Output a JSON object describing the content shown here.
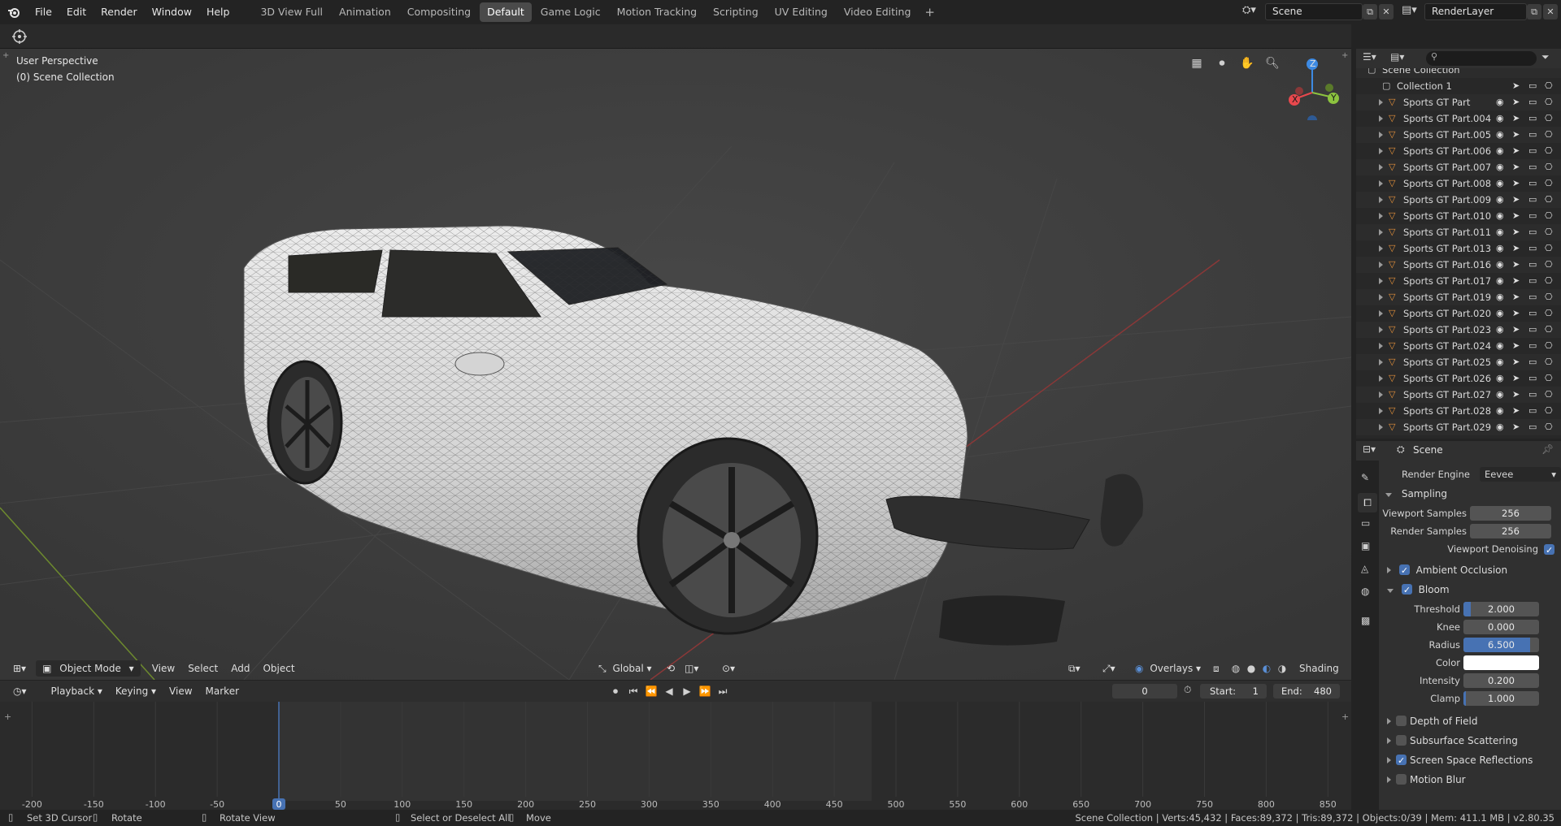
{
  "menu": [
    "File",
    "Edit",
    "Render",
    "Window",
    "Help"
  ],
  "workspaces": [
    {
      "label": "3D View Full",
      "active": false
    },
    {
      "label": "Animation",
      "active": false
    },
    {
      "label": "Compositing",
      "active": false
    },
    {
      "label": "Default",
      "active": true
    },
    {
      "label": "Game Logic",
      "active": false
    },
    {
      "label": "Motion Tracking",
      "active": false
    },
    {
      "label": "Scripting",
      "active": false
    },
    {
      "label": "UV Editing",
      "active": false
    },
    {
      "label": "Video Editing",
      "active": false
    }
  ],
  "scene_name": "Scene",
  "render_layer": "RenderLayer",
  "viewport": {
    "perspective": "User Perspective",
    "collection": "(0) Scene Collection",
    "mode": "Object Mode",
    "menus": [
      "View",
      "Select",
      "Add",
      "Object"
    ],
    "orientation": "Global",
    "overlays": "Overlays",
    "shading": "Shading",
    "gizmo": {
      "x": "X",
      "y": "Y",
      "z": "Z"
    }
  },
  "timeline": {
    "menus": [
      "Playback",
      "Keying",
      "View",
      "Marker"
    ],
    "current_frame": "0",
    "start_label": "Start:",
    "start": "1",
    "end_label": "End:",
    "end": "480",
    "ruler": [
      "-200",
      "-150",
      "-100",
      "-50",
      "0",
      "50",
      "100",
      "150",
      "200",
      "250",
      "300",
      "350",
      "400",
      "450",
      "500",
      "550",
      "600",
      "650",
      "700",
      "750",
      "800",
      "850"
    ]
  },
  "outliner": {
    "root": "Scene Collection",
    "collection": "Collection 1",
    "objects": [
      "Sports GT Part",
      "Sports GT Part.004",
      "Sports GT Part.005",
      "Sports GT Part.006",
      "Sports GT Part.007",
      "Sports GT Part.008",
      "Sports GT Part.009",
      "Sports GT Part.010",
      "Sports GT Part.011",
      "Sports GT Part.013",
      "Sports GT Part.016",
      "Sports GT Part.017",
      "Sports GT Part.019",
      "Sports GT Part.020",
      "Sports GT Part.023",
      "Sports GT Part.024",
      "Sports GT Part.025",
      "Sports GT Part.026",
      "Sports GT Part.027",
      "Sports GT Part.028",
      "Sports GT Part.029"
    ]
  },
  "properties": {
    "context": "Scene",
    "render_engine_label": "Render Engine",
    "render_engine": "Eevee",
    "sampling": {
      "title": "Sampling",
      "viewport_samples_label": "Viewport Samples",
      "viewport_samples": "256",
      "render_samples_label": "Render Samples",
      "render_samples": "256",
      "viewport_denoising": "Viewport Denoising"
    },
    "ambient_occlusion": "Ambient Occlusion",
    "bloom": {
      "title": "Bloom",
      "fields": [
        {
          "label": "Threshold",
          "value": "2.000",
          "fill": 0.1
        },
        {
          "label": "Knee",
          "value": "0.000",
          "fill": 0
        },
        {
          "label": "Radius",
          "value": "6.500",
          "fill": 0.88
        },
        {
          "label": "Color",
          "value": "",
          "fill": 0
        },
        {
          "label": "Intensity",
          "value": "0.200",
          "fill": 0
        },
        {
          "label": "Clamp",
          "value": "1.000",
          "fill": 0.03
        }
      ]
    },
    "panels_after": [
      {
        "label": "Depth of Field",
        "checked": false
      },
      {
        "label": "Subsurface Scattering",
        "checked": false
      },
      {
        "label": "Screen Space Reflections",
        "checked": true
      },
      {
        "label": "Motion Blur",
        "checked": false
      }
    ]
  },
  "status": {
    "set_cursor": "Set 3D Cursor",
    "rotate": "Rotate",
    "rotate_view": "Rotate View",
    "select": "Select or Deselect All",
    "move": "Move",
    "stats": "Scene Collection | Verts:45,432 | Faces:89,372 | Tris:89,372 | Objects:0/39 | Mem: 411.1 MB | v2.80.35"
  },
  "colors": {
    "accent": "#4772b3",
    "object_icon": "#e5913a",
    "axis_x": "#e8484d",
    "axis_y": "#8cc33f",
    "axis_z": "#3d8ae3"
  }
}
